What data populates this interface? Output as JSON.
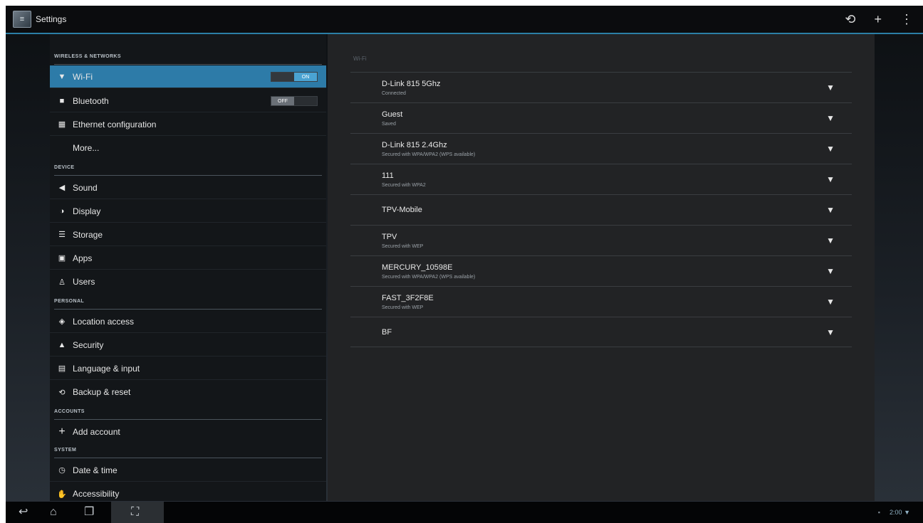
{
  "action_bar": {
    "app_icon": "settings-app-icon",
    "title": "Settings",
    "actions": [
      {
        "icon": "refresh-wps-icon",
        "glyph": "⟲"
      },
      {
        "icon": "add-icon",
        "glyph": "+"
      },
      {
        "icon": "overflow-menu-icon",
        "glyph": "⋮"
      }
    ]
  },
  "sidebar": {
    "sections": {
      "wireless": "WIRELESS & NETWORKS",
      "device": "DEVICE",
      "personal": "PERSONAL",
      "accounts": "ACCOUNTS",
      "system": "SYSTEM"
    },
    "items": [
      {
        "label": "Wi-Fi",
        "icon": "wifi-icon",
        "glyph": "▼",
        "toggle": "ON"
      },
      {
        "label": "Bluetooth",
        "icon": "bluetooth-icon",
        "glyph": "■",
        "toggle": "OFF"
      },
      {
        "label": "Ethernet configuration",
        "icon": "ethernet-icon",
        "glyph": "▦"
      },
      {
        "label": "More...",
        "icon": ""
      },
      {
        "label": "Sound",
        "icon": "sound-icon",
        "glyph": "◀)"
      },
      {
        "label": "Display",
        "icon": "display-icon",
        "glyph": "◑"
      },
      {
        "label": "Storage",
        "icon": "storage-icon",
        "glyph": "☰"
      },
      {
        "label": "Apps",
        "icon": "apps-icon",
        "glyph": "▣"
      },
      {
        "label": "Users",
        "icon": "users-icon",
        "glyph": "♙"
      },
      {
        "label": "Location access",
        "icon": "location-icon",
        "glyph": "◈"
      },
      {
        "label": "Security",
        "icon": "lock-icon",
        "glyph": "⊓"
      },
      {
        "label": "Language & input",
        "icon": "keyboard-icon",
        "glyph": "▤"
      },
      {
        "label": "Backup & reset",
        "icon": "backup-icon",
        "glyph": "⟲"
      },
      {
        "label": "Add account",
        "icon": "add-icon",
        "glyph": "+"
      },
      {
        "label": "Date & time",
        "icon": "clock-icon",
        "glyph": "◷"
      },
      {
        "label": "Accessibility",
        "icon": "accessibility-icon",
        "glyph": "✋"
      }
    ]
  },
  "wifi_panel": {
    "header": "Wi-Fi",
    "networks": [
      {
        "ssid": "D-Link 815 5Ghz",
        "status": "Connected",
        "secured": false
      },
      {
        "ssid": "Guest",
        "status": "Saved",
        "secured": false
      },
      {
        "ssid": "D-Link 815 2.4Ghz",
        "status": "Secured with WPA/WPA2 (WPS available)",
        "secured": true
      },
      {
        "ssid": "111",
        "status": "Secured with WPA2",
        "secured": true
      },
      {
        "ssid": "TPV-Mobile",
        "status": "",
        "secured": false
      },
      {
        "ssid": "TPV",
        "status": "Secured with WEP",
        "secured": true
      },
      {
        "ssid": "MERCURY_10598E",
        "status": "Secured with WPA/WPA2 (WPS available)",
        "secured": true
      },
      {
        "ssid": "FAST_3F2F8E",
        "status": "Secured with WEP",
        "secured": true
      },
      {
        "ssid": "BF",
        "status": "",
        "secured": false
      }
    ]
  },
  "nav_bar": {
    "back": "back-icon",
    "home": "home-icon",
    "recents": "recent-apps-icon",
    "screenshot": "screenshot-icon",
    "time": "2:00",
    "status_icons": [
      "sd-card-icon",
      "wifi-signal-icon"
    ]
  },
  "colors": {
    "accent": "#2d7ba8",
    "action_bar_divider": "#2b7fa6",
    "panel_bg": "#222325",
    "sidebar_bg": "#131619"
  }
}
